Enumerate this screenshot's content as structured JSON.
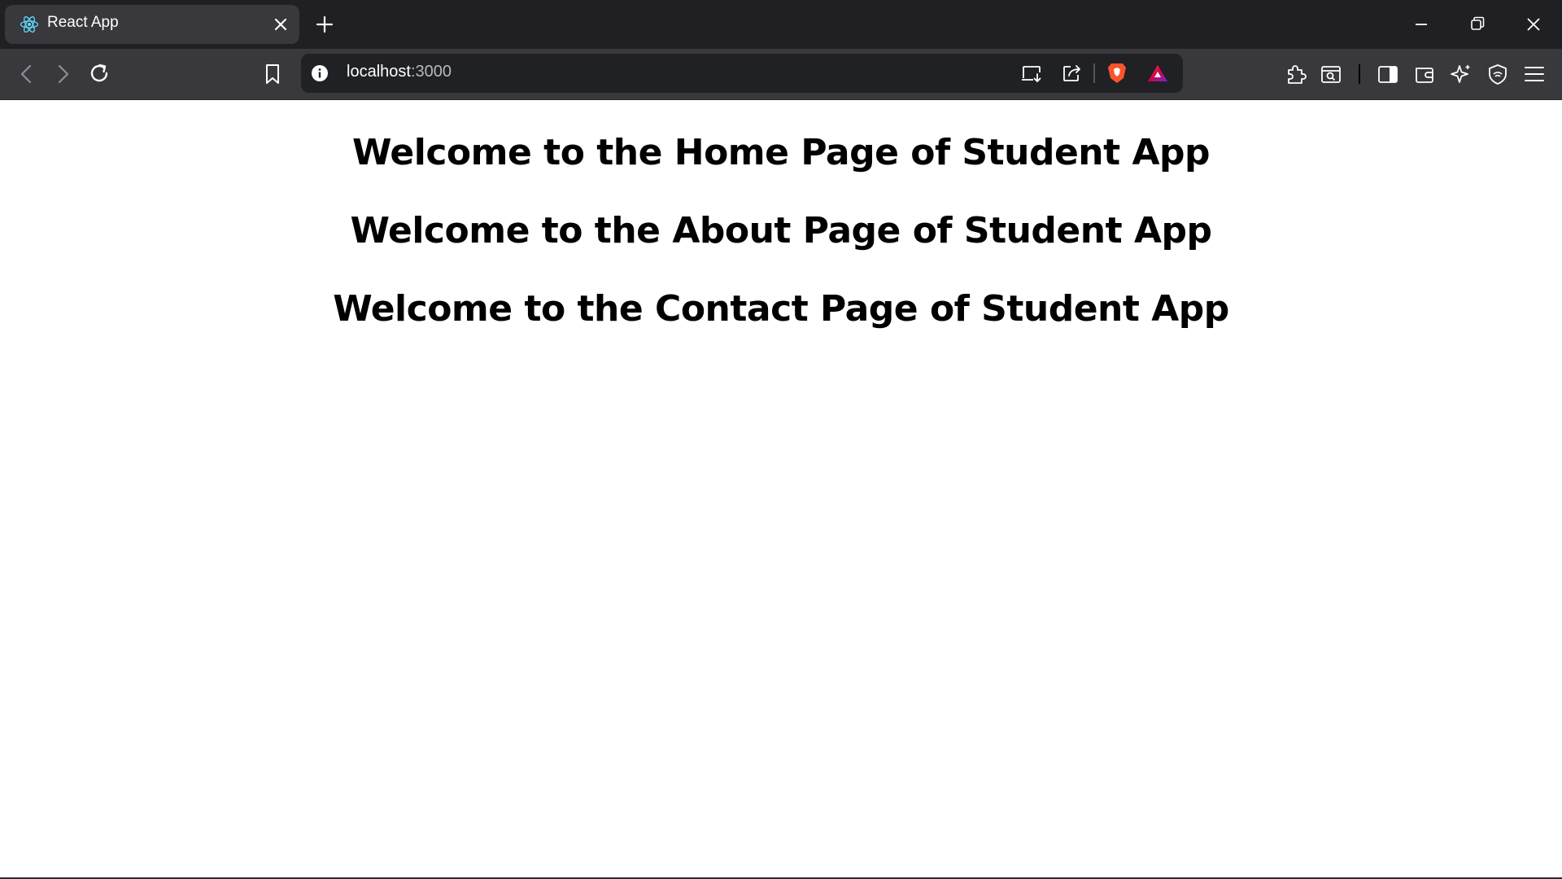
{
  "browser": {
    "tab": {
      "title": "React App",
      "favicon": "react-logo-icon"
    },
    "address_bar": {
      "host": "localhost",
      "port": ":3000"
    },
    "colors": {
      "titlebar": "#1f1f24",
      "toolbar": "#38383d",
      "urlbar": "#202124",
      "brave_orange": "#fb542b"
    }
  },
  "page": {
    "headings": [
      "Welcome to the Home Page of Student App",
      "Welcome to the About Page of Student App",
      "Welcome to the Contact Page of Student App"
    ]
  }
}
